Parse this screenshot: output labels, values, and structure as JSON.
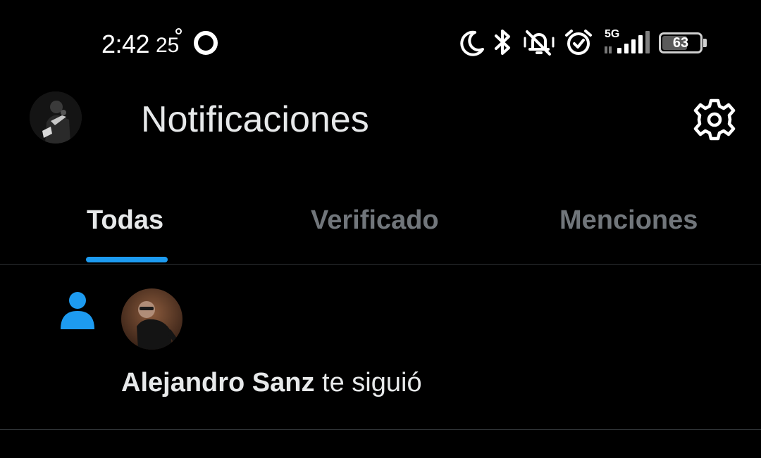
{
  "status_bar": {
    "time": "2:42",
    "temperature": "25",
    "network": "5G",
    "battery": "63",
    "battery_level": 0.63,
    "icons": [
      "moon-icon",
      "bluetooth-icon",
      "muted-vibrate-icon",
      "alarm-icon",
      "signal-icon",
      "battery-icon"
    ]
  },
  "header": {
    "title": "Notificaciones",
    "avatar_icon": "profile-avatar",
    "settings_icon": "gear-icon"
  },
  "tabs": [
    {
      "label": "Todas",
      "active": true
    },
    {
      "label": "Verificado",
      "active": false
    },
    {
      "label": "Menciones",
      "active": false
    }
  ],
  "notifications": [
    {
      "type_icon": "person-icon",
      "name": "Alejandro Sanz",
      "action": " te siguió"
    }
  ],
  "colors": {
    "background": "#000000",
    "accent": "#1d9bf0",
    "text_primary": "#e7e9ea",
    "text_secondary": "#71767b",
    "divider": "#2f3336"
  }
}
